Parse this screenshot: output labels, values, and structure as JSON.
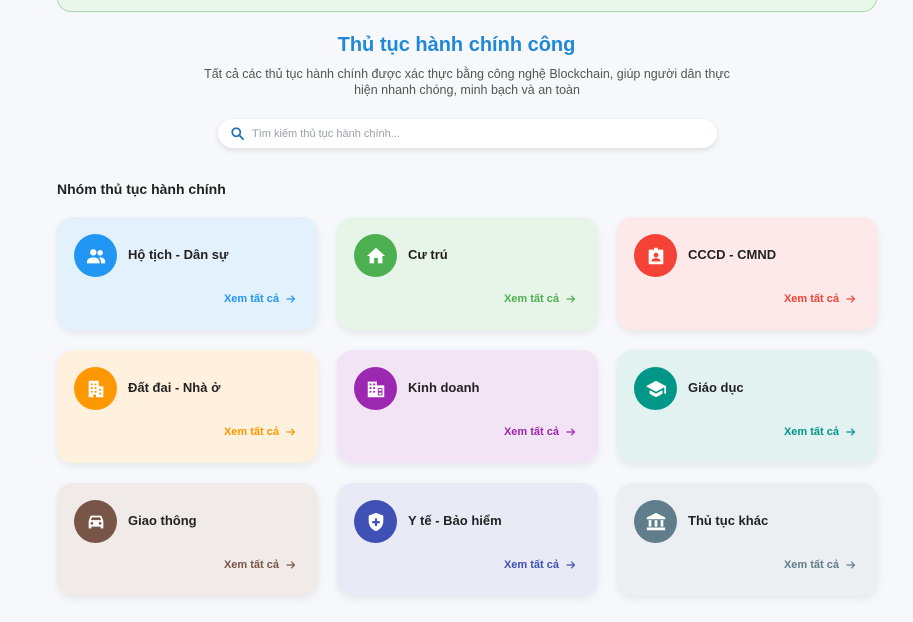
{
  "hero": {
    "title": "Thủ tục hành chính công",
    "subtitle_line1": "Tất cả các thủ tục hành chính được xác thực bằng công nghệ Blockchain, giúp người dân thực",
    "subtitle_line2": "hiện nhanh chóng, minh bạch và an toàn"
  },
  "search": {
    "placeholder": "Tìm kiếm thủ tục hành chính...",
    "value": ""
  },
  "section": {
    "title": "Nhóm thủ tục hành chính"
  },
  "categories": [
    {
      "name": "Hộ tịch - Dân sự",
      "link": "Xem tất cả",
      "icon": "people-icon",
      "bg": "#e3f1fd",
      "accent": "#2196f3"
    },
    {
      "name": "Cư trú",
      "link": "Xem tất cả",
      "icon": "home-icon",
      "bg": "#e7f5e8",
      "accent": "#4caf50"
    },
    {
      "name": "CCCD - CMND",
      "link": "Xem tất cả",
      "icon": "id-badge-icon",
      "bg": "#fde8ea",
      "accent": "#f44336"
    },
    {
      "name": "Đất đai - Nhà ở",
      "link": "Xem tất cả",
      "icon": "building-icon",
      "bg": "#fff1de",
      "accent": "#ff9800"
    },
    {
      "name": "Kinh doanh",
      "link": "Xem tất cả",
      "icon": "business-icon",
      "bg": "#f3e4f5",
      "accent": "#9c27b0"
    },
    {
      "name": "Giáo dục",
      "link": "Xem tất cả",
      "icon": "graduation-cap-icon",
      "bg": "#e1f2f0",
      "accent": "#009688"
    },
    {
      "name": "Giao thông",
      "link": "Xem tất cả",
      "icon": "car-icon",
      "bg": "#f0ebe8",
      "accent": "#795548"
    },
    {
      "name": "Y tế - Bảo hiểm",
      "link": "Xem tất cả",
      "icon": "health-shield-icon",
      "bg": "#e8eaf6",
      "accent": "#3f51b5"
    },
    {
      "name": "Thủ tục khác",
      "link": "Xem tất cả",
      "icon": "institution-icon",
      "bg": "#eceff1",
      "accent": "#607d8b"
    }
  ]
}
